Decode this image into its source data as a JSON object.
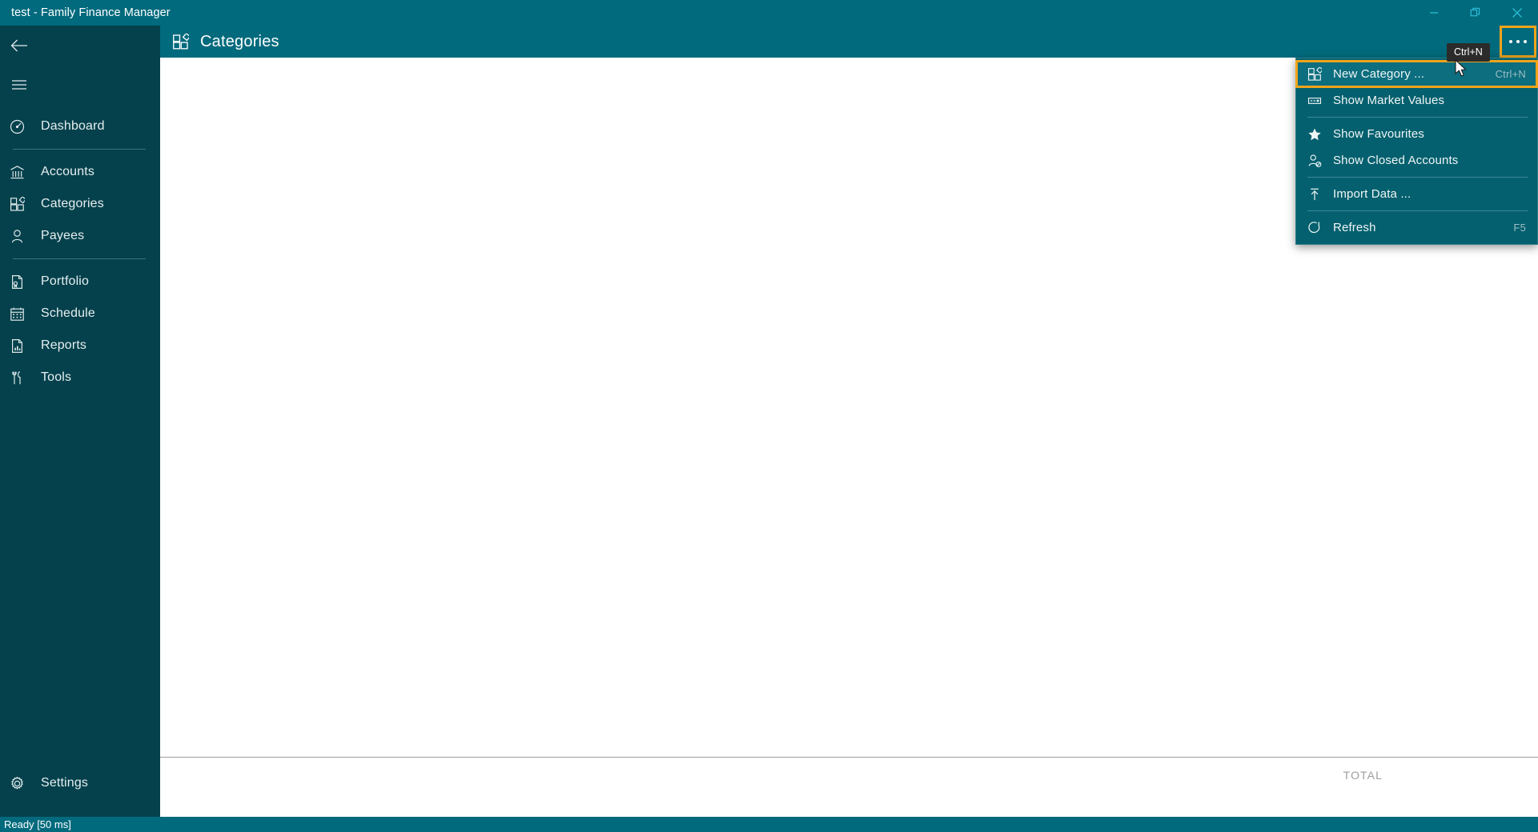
{
  "window": {
    "title": "test - Family Finance Manager",
    "minimize_label": "Minimize",
    "restore_label": "Restore",
    "close_label": "Close"
  },
  "colors": {
    "titlebar": "#026A7D",
    "sidebar": "#04414C",
    "accent_highlight": "#F0A41B",
    "menu_bg": "#04606E",
    "content_bg": "#FFFFFF",
    "tooltip_bg": "#2B2B2B",
    "total_text": "#9D9D9D"
  },
  "sidebar": {
    "back_icon": "back-arrow-icon",
    "menu_icon": "hamburger-icon",
    "items": [
      {
        "label": "Dashboard",
        "icon": "dashboard-gauge-icon"
      },
      {
        "label": "Accounts",
        "icon": "bank-icon"
      },
      {
        "label": "Categories",
        "icon": "categories-grid-icon"
      },
      {
        "label": "Payees",
        "icon": "person-icon"
      },
      {
        "label": "Portfolio",
        "icon": "document-seal-icon"
      },
      {
        "label": "Schedule",
        "icon": "calendar-icon"
      },
      {
        "label": "Reports",
        "icon": "report-chart-icon"
      },
      {
        "label": "Tools",
        "icon": "tools-icon"
      }
    ],
    "settings": {
      "label": "Settings",
      "icon": "gear-icon"
    }
  },
  "header": {
    "title": "Categories",
    "icon": "categories-grid-icon",
    "overflow_icon": "ellipsis-icon"
  },
  "tooltip": {
    "text": "Ctrl+N"
  },
  "menu": {
    "items": [
      {
        "label": "New Category ...",
        "icon": "categories-grid-icon",
        "accel": "Ctrl+N",
        "highlighted": true
      },
      {
        "label": "Show Market Values",
        "icon": "market-values-icon",
        "accel": "",
        "highlighted": false
      },
      {
        "label": "Show Favourites",
        "icon": "star-icon",
        "accel": "",
        "highlighted": false
      },
      {
        "label": "Show Closed Accounts",
        "icon": "person-blocked-icon",
        "accel": "",
        "highlighted": false
      },
      {
        "label": "Import Data ...",
        "icon": "import-arrow-icon",
        "accel": "",
        "highlighted": false
      },
      {
        "label": "Refresh",
        "icon": "refresh-icon",
        "accel": "F5",
        "highlighted": false
      }
    ]
  },
  "content": {
    "total_label": "TOTAL",
    "rows": []
  },
  "statusbar": {
    "text": "Ready [50 ms]"
  }
}
